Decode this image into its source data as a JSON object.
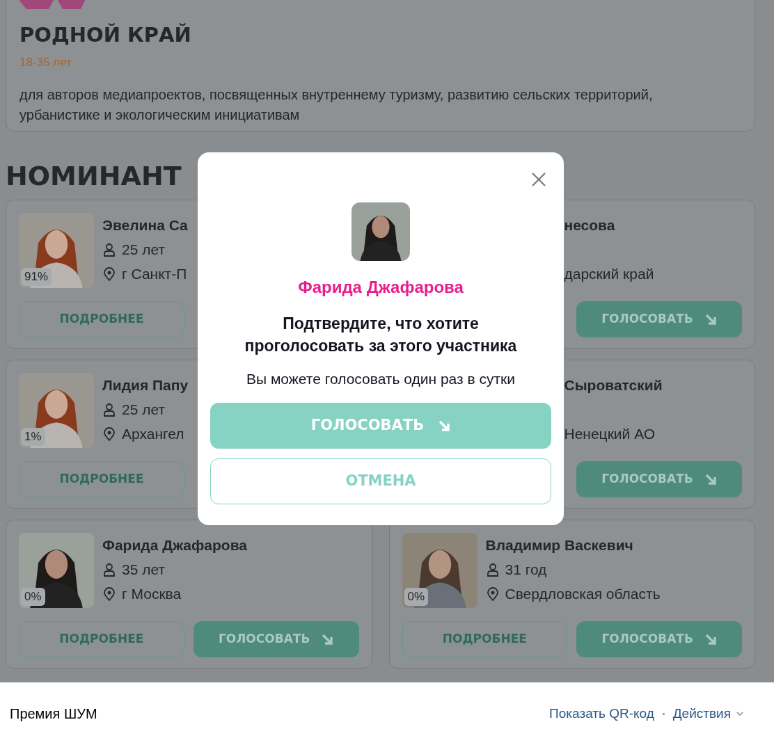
{
  "top_card": {
    "title": "РОДНОЙ КРАЙ",
    "age_range": "18-35 лет",
    "description": "для авторов медиапроектов, посвященных внутреннему туризму, развитию сельских территорий, урбанистике и экологическим инициативам"
  },
  "section_title": "НОМИНАНТ",
  "nominees": [
    {
      "kind": "left_cut",
      "name": "Эвелина Са",
      "age": "25 лет",
      "location": "г Санкт-П",
      "percent": "91%",
      "buttons": [
        {
          "kind": "outline",
          "label": "ПОДРОБНЕЕ"
        }
      ]
    },
    {
      "kind": "right_cut",
      "name": "несова",
      "location": "дарский край",
      "buttons": [
        {
          "kind": "filled",
          "label": "ГОЛОСОВАТЬ"
        }
      ]
    },
    {
      "kind": "left_cut",
      "name": "Лидия Папу",
      "age": "25 лет",
      "location": "Архангел",
      "percent": "1%",
      "buttons": [
        {
          "kind": "outline",
          "label": "ПОДРОБНЕЕ"
        }
      ]
    },
    {
      "kind": "right_cut",
      "name": "Сыроватский",
      "location": "Ненецкий АО",
      "buttons": [
        {
          "kind": "filled",
          "label": "ГОЛОСОВАТЬ"
        }
      ]
    },
    {
      "kind": "full",
      "name": "Фарида Джафарова",
      "age": "35 лет",
      "location": "г Москва",
      "percent": "0%",
      "buttons": [
        {
          "kind": "outline",
          "label": "ПОДРОБНЕЕ"
        },
        {
          "kind": "filled",
          "label": "ГОЛОСОВАТЬ"
        }
      ]
    },
    {
      "kind": "full",
      "name": "Владимир Васкевич",
      "age": "31 год",
      "location": "Свердловская область",
      "percent": "0%",
      "buttons": [
        {
          "kind": "outline",
          "label": "ПОДРОБНЕЕ"
        },
        {
          "kind": "filled",
          "label": "ГОЛОСОВАТЬ"
        }
      ]
    }
  ],
  "modal": {
    "name": "Фарида Джафарова",
    "question": "Подтвердите, что хотите проголосовать за этого участника",
    "note": "Вы можете голосовать один раз в сутки",
    "confirm": "ГОЛОСОВАТЬ",
    "cancel": "ОТМЕНА"
  },
  "footer": {
    "title": "Премия ШУМ",
    "qr_link": "Показать QR-код",
    "actions": "Действия"
  }
}
